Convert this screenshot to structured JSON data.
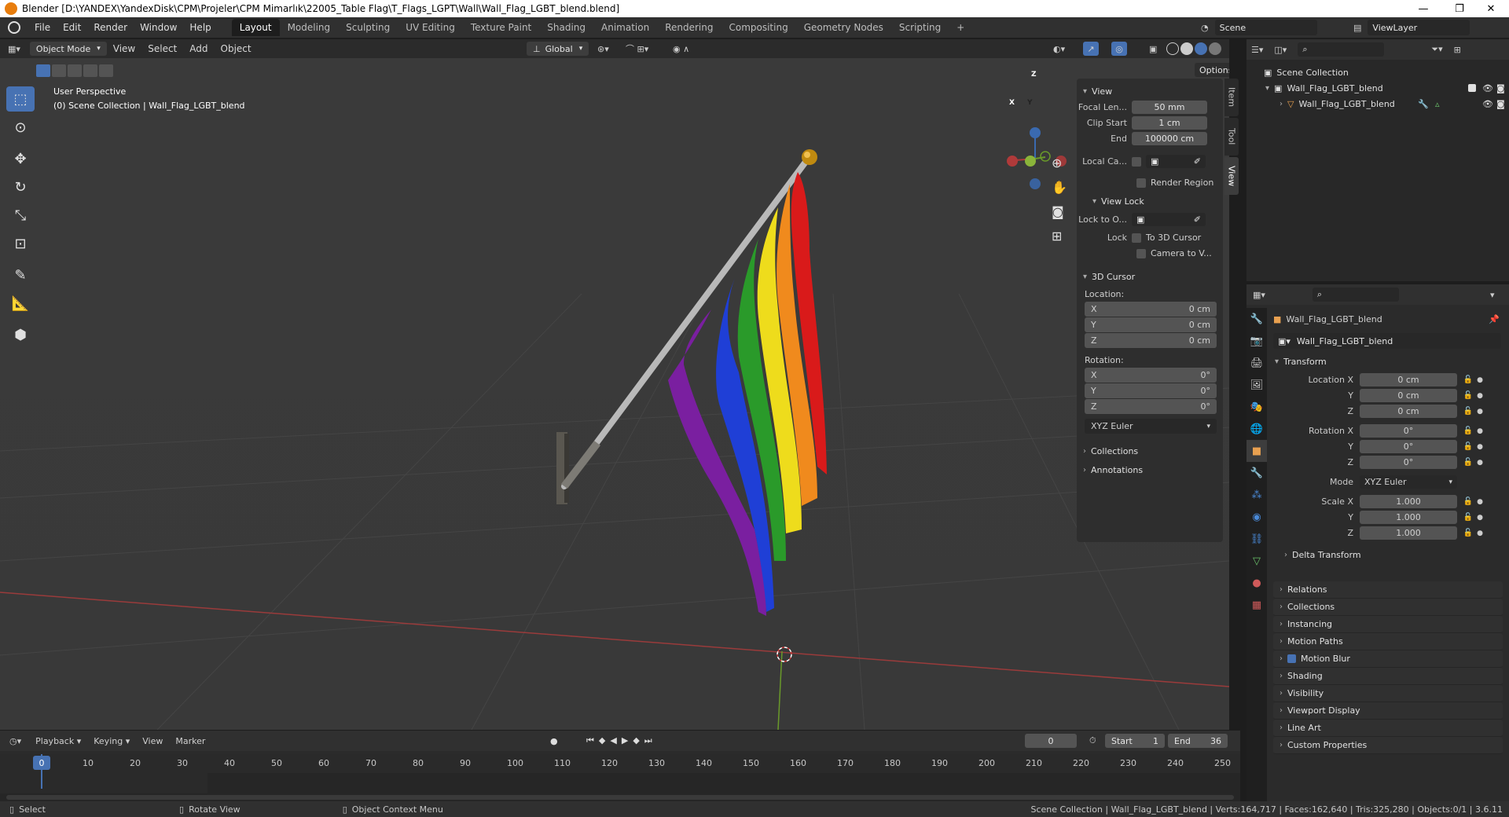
{
  "window": {
    "title": "Blender [D:\\YANDEX\\YandexDisk\\CPM\\Projeler\\CPM Mimarlık\\22005_Table Flag\\T_Flags_LGPT\\Wall\\Wall_Flag_LGBT_blend.blend]",
    "minimize": "—",
    "maximize": "❐",
    "close": "✕"
  },
  "menu": [
    "File",
    "Edit",
    "Render",
    "Window",
    "Help"
  ],
  "workspaces": [
    "Layout",
    "Modeling",
    "Sculpting",
    "UV Editing",
    "Texture Paint",
    "Shading",
    "Animation",
    "Rendering",
    "Compositing",
    "Geometry Nodes",
    "Scripting"
  ],
  "add_workspace": "+",
  "scene": {
    "label": "Scene",
    "viewlayer": "ViewLayer"
  },
  "viewport_header": {
    "mode": "Object Mode",
    "items": [
      "View",
      "Select",
      "Add",
      "Object"
    ],
    "orientation": "Global",
    "options": "Options"
  },
  "viewport": {
    "perspective": "User Perspective",
    "collection_info": "(0) Scene Collection | Wall_Flag_LGBT_blend",
    "gizmo": {
      "x": "X",
      "y": "Y",
      "z": "Z"
    }
  },
  "npanel": {
    "tabs": [
      "Item",
      "Tool",
      "View"
    ],
    "view_section": "View",
    "focal_label": "Focal Len...",
    "focal_value": "50 mm",
    "clip_start_label": "Clip Start",
    "clip_start_value": "1 cm",
    "end_label": "End",
    "end_value": "100000 cm",
    "local_camera_label": "Local Ca...",
    "render_region": "Render Region",
    "view_lock_section": "View Lock",
    "lock_to_object_label": "Lock to O...",
    "lock_label": "Lock",
    "to_3d_cursor": "To 3D Cursor",
    "camera_to_view": "Camera to V...",
    "cursor_section": "3D Cursor",
    "location_label": "Location:",
    "loc": [
      {
        "axis": "X",
        "value": "0 cm"
      },
      {
        "axis": "Y",
        "value": "0 cm"
      },
      {
        "axis": "Z",
        "value": "0 cm"
      }
    ],
    "rotation_label": "Rotation:",
    "rot": [
      {
        "axis": "X",
        "value": "0°"
      },
      {
        "axis": "Y",
        "value": "0°"
      },
      {
        "axis": "Z",
        "value": "0°"
      }
    ],
    "rotation_mode": "XYZ Euler",
    "collections": "Collections",
    "annotations": "Annotations"
  },
  "outliner": {
    "scene_collection": "Scene Collection",
    "collection": "Wall_Flag_LGBT_blend",
    "object": "Wall_Flag_LGBT_blend"
  },
  "properties": {
    "object_name": "Wall_Flag_LGBT_blend",
    "data_name": "Wall_Flag_LGBT_blend",
    "transform": "Transform",
    "location_x_label": "Location X",
    "rotation_x_label": "Rotation X",
    "scale_x_label": "Scale X",
    "y_label": "Y",
    "z_label": "Z",
    "location": [
      "0 cm",
      "0 cm",
      "0 cm"
    ],
    "rotation": [
      "0°",
      "0°",
      "0°"
    ],
    "mode_label": "Mode",
    "mode_value": "XYZ Euler",
    "scale": [
      "1.000",
      "1.000",
      "1.000"
    ],
    "delta_transform": "Delta Transform",
    "panels": [
      "Relations",
      "Collections",
      "Instancing",
      "Motion Paths",
      "Motion Blur",
      "Shading",
      "Visibility",
      "Viewport Display",
      "Line Art",
      "Custom Properties"
    ]
  },
  "timeline": {
    "menus": [
      "Playback",
      "Keying",
      "View",
      "Marker"
    ],
    "current_frame": "0",
    "start_label": "Start",
    "start_value": "1",
    "end_label": "End",
    "end_value": "36",
    "ticks": [
      "0",
      "10",
      "20",
      "30",
      "40",
      "50",
      "60",
      "70",
      "80",
      "90",
      "100",
      "110",
      "120",
      "130",
      "140",
      "150",
      "160",
      "170",
      "180",
      "190",
      "200",
      "210",
      "220",
      "230",
      "240",
      "250"
    ]
  },
  "statusbar": {
    "select": "Select",
    "rotate": "Rotate View",
    "context_menu": "Object Context Menu",
    "info": "Scene Collection | Wall_Flag_LGBT_blend | Verts:164,717 | Faces:162,640 | Tris:325,280 | Objects:0/1 | 3.6.11"
  },
  "colors": {
    "accent": "#4772b3",
    "flag": [
      "#d91a1a",
      "#f08a1d",
      "#eedc1c",
      "#2a9a2a",
      "#1f3fd6",
      "#7a1fa0"
    ]
  }
}
